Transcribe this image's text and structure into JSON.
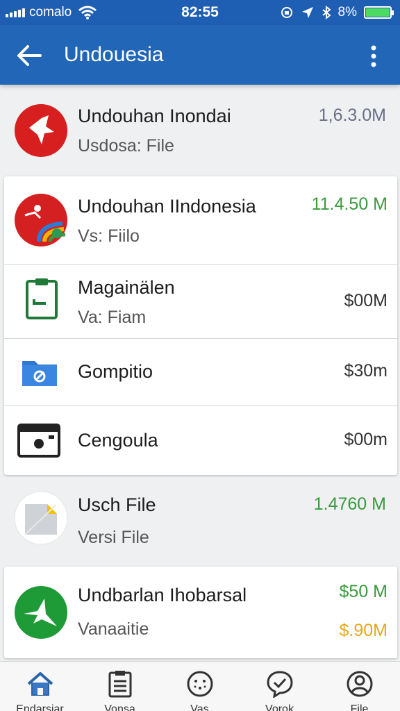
{
  "status_bar": {
    "carrier": "comalo",
    "time": "82:55",
    "battery": "8%",
    "battery_level": 1.0
  },
  "app_bar": {
    "title": "Undouesia",
    "back_icon": "arrow-left-icon",
    "menu_icon": "more-vertical-icon"
  },
  "items": [
    {
      "title": "Undouhan Inondai",
      "subtitle": "Usdosa: File",
      "size": "1,6.3.0M",
      "size_color": "#6b6f86",
      "icon": "red-star-app-icon"
    },
    {
      "title": "Undouhan IIndonesia",
      "subtitle": "Vs: Fiilo",
      "size": "11.4.50 M",
      "size_color": "#3a9a3e",
      "icon": "red-rainbow-app-icon"
    },
    {
      "title": "Magainälen",
      "subtitle": "Va: Fiam",
      "size": "$00M",
      "size_color": "#333333",
      "icon": "clipboard-icon"
    },
    {
      "title": "Gompitio",
      "subtitle": "",
      "size": "$30m",
      "size_color": "#333333",
      "icon": "blue-folder-icon"
    },
    {
      "title": "Cengoula",
      "subtitle": "",
      "size": "$00m",
      "size_color": "#333333",
      "icon": "camera-icon"
    },
    {
      "title": "Usch File",
      "subtitle": "Versi File",
      "size": "1.4760 M",
      "size_color": "#3a9a3e",
      "icon": "document-file-icon"
    },
    {
      "title": "Undbarlan Ihobarsal",
      "subtitle": "Vanaaitie",
      "size": "$50 M",
      "size2": "$.90M",
      "size_color": "#3a9a3e",
      "size2_color": "#e6a817",
      "icon": "green-bird-app-icon"
    }
  ],
  "bottom_nav": [
    {
      "label": "Endarsiar",
      "icon": "home-icon"
    },
    {
      "label": "Vonsa",
      "icon": "clipboard-list-icon"
    },
    {
      "label": "Vas",
      "icon": "face-icon"
    },
    {
      "label": "Vorok",
      "icon": "chat-check-icon"
    },
    {
      "label": "File",
      "icon": "user-circle-icon"
    }
  ]
}
